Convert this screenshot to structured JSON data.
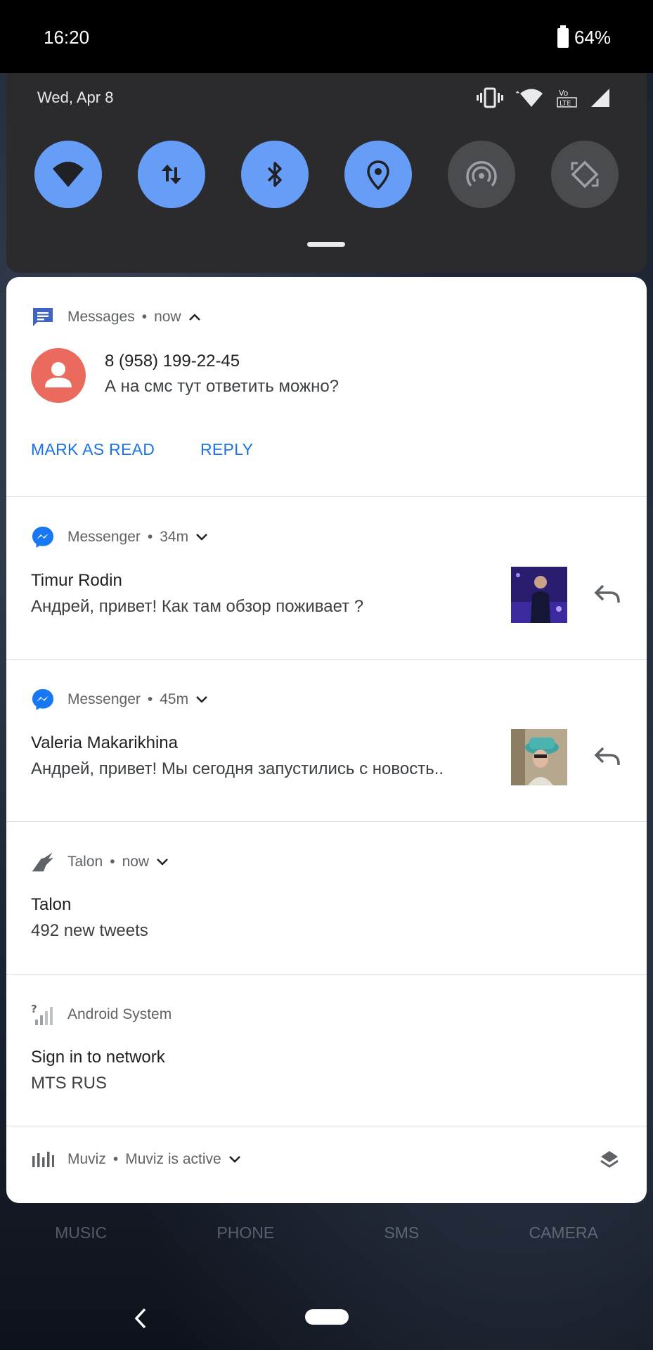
{
  "status_bar": {
    "time": "16:20",
    "battery": "64%"
  },
  "quick_settings": {
    "date": "Wed, Apr 8",
    "tiles": [
      {
        "name": "wifi-icon",
        "state": "on"
      },
      {
        "name": "mobile-data-icon",
        "state": "on"
      },
      {
        "name": "bluetooth-icon",
        "state": "on"
      },
      {
        "name": "location-icon",
        "state": "on"
      },
      {
        "name": "hotspot-icon",
        "state": "off"
      },
      {
        "name": "auto-rotate-icon",
        "state": "off"
      }
    ],
    "lte_badge": "LTE",
    "volte_badge": "Vo"
  },
  "notifications": {
    "messages": {
      "app": "Messages",
      "time": "now",
      "title": "8 (958) 199-22-45",
      "text": "А на смс тут ответить можно?",
      "action_mark": "MARK AS READ",
      "action_reply": "REPLY"
    },
    "messenger1": {
      "app": "Messenger",
      "time": "34m",
      "title": "Timur Rodin",
      "text": "Андрей, привет! Как там обзор поживает ?"
    },
    "messenger2": {
      "app": "Messenger",
      "time": "45m",
      "title": "Valeria Makarikhina",
      "text": "Андрей, привет! Мы сегодня запустились с новость.."
    },
    "talon": {
      "app": "Talon",
      "time": "now",
      "title": "Talon",
      "text": "492 new tweets"
    },
    "android_system": {
      "app": "Android System",
      "title": "Sign in to network",
      "text": "MTS RUS"
    },
    "muviz": {
      "app": "Muviz",
      "status": "Muviz is active"
    }
  },
  "separator": "•",
  "dock": [
    "MUSIC",
    "PHONE",
    "SMS",
    "CAMERA"
  ],
  "colors": {
    "accent": "#1a73e8",
    "tile_on": "#669df6",
    "tile_off": "#4a4b4e"
  }
}
